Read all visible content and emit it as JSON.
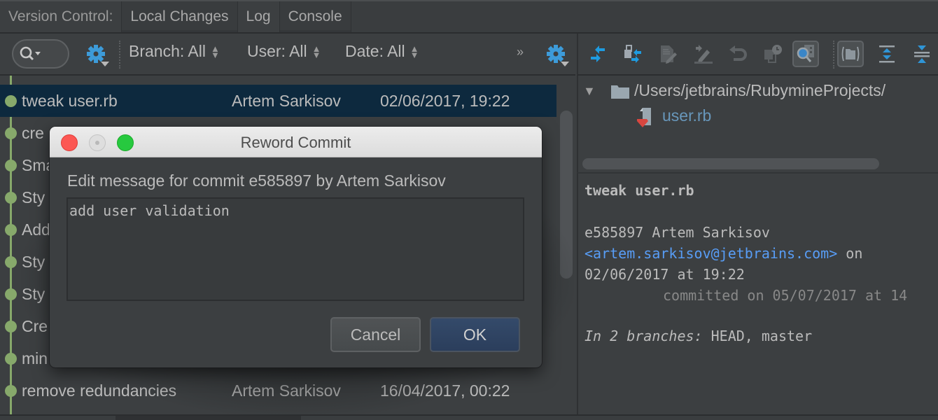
{
  "tabbar": {
    "label": "Version Control:",
    "tabs": [
      {
        "label": "Local Changes"
      },
      {
        "label": "Log"
      },
      {
        "label": "Console"
      }
    ]
  },
  "toolbar": {
    "filters": {
      "branch": "Branch: All",
      "user": "User: All",
      "date": "Date: All"
    },
    "more": "»",
    "right_icons": [
      "collapse-arrows-icon",
      "cherry-pick-icon",
      "edit-source-icon",
      "reword-icon",
      "revert-icon",
      "history-icon",
      "preview-diff-icon",
      "group-by-directory-icon",
      "expand-all-icon",
      "collapse-all-icon"
    ]
  },
  "log": {
    "rows": [
      {
        "subject": "tweak user.rb",
        "author": "Artem Sarkisov",
        "date": "02/06/2017, 19:22",
        "selected": true
      },
      {
        "subject": "cre",
        "author": "",
        "date": ""
      },
      {
        "subject": "Sma",
        "author": "",
        "date": ""
      },
      {
        "subject": "Sty",
        "author": "",
        "date": ""
      },
      {
        "subject": "Add",
        "author": "",
        "date": ""
      },
      {
        "subject": "Sty",
        "author": "",
        "date": ""
      },
      {
        "subject": "Sty",
        "author": "",
        "date": ""
      },
      {
        "subject": "Cre",
        "author": "",
        "date": ""
      },
      {
        "subject": "min",
        "author": "",
        "date": ""
      },
      {
        "subject": "remove redundancies",
        "author": "Artem Sarkisov",
        "date": "16/04/2017, 00:22"
      }
    ],
    "graph_color": "#87a96b"
  },
  "dialog": {
    "title": "Reword Commit",
    "label": "Edit message for commit e585897 by Artem Sarkisov",
    "message": "add user validation",
    "cancel": "Cancel",
    "ok": "OK"
  },
  "changes": {
    "folder": "/Users/jetbrains/RubymineProjects/",
    "file": "user.rb"
  },
  "details": {
    "subject": "tweak user.rb",
    "hash_author": "e585897 Artem Sarkisov",
    "email": "<artem.sarkisov@jetbrains.com>",
    "on": " on",
    "authored": "02/06/2017 at 19:22",
    "committed": "committed on 05/07/2017 at 14",
    "branches_label": "In 2 branches:",
    "branches": " HEAD, master"
  },
  "colors": {
    "accent_blue": "#3592c4",
    "link": "#589df6",
    "selection": "#0d293e"
  }
}
